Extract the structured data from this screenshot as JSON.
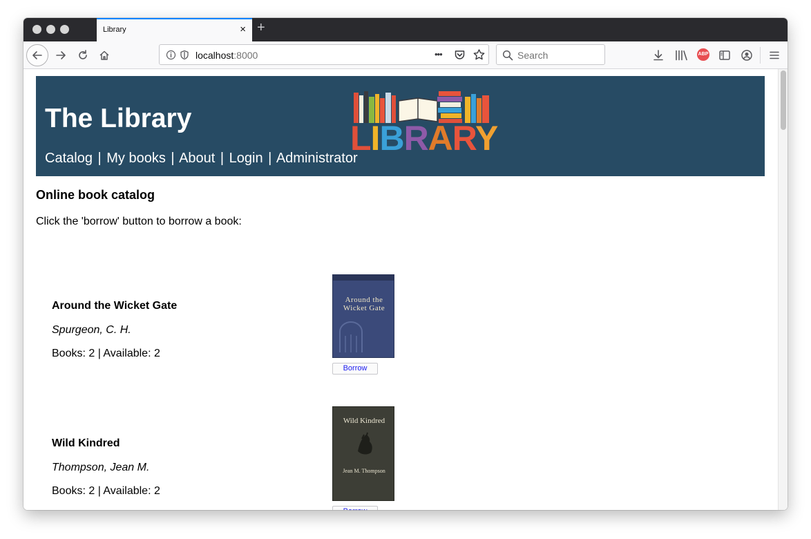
{
  "browser": {
    "tab_title": "Library",
    "tab_close": "×",
    "new_tab": "+",
    "url_host": "localhost",
    "url_port": ":8000",
    "search_placeholder": "Search",
    "page_actions_label": "•••",
    "abp_label": "ABP"
  },
  "header": {
    "site_title": "The Library",
    "nav": [
      "Catalog",
      "My books",
      "About",
      "Login",
      "Administrator"
    ],
    "nav_separator": "|",
    "logo_text": [
      "L",
      "I",
      "B",
      "R",
      "A",
      "R",
      "Y"
    ],
    "logo_colors": [
      "#e0503a",
      "#f0b429",
      "#3aa0d8",
      "#8e5aa8",
      "#e07b2a",
      "#e8543c",
      "#f0a030"
    ]
  },
  "main": {
    "heading": "Online book catalog",
    "intro": "Click the 'borrow' button to borrow a book:",
    "borrow_label": "Borrow",
    "books": [
      {
        "title": "Around the Wicket Gate",
        "author": "Spurgeon, C. H.",
        "stock": "Books: 2 | Available: 2",
        "cover_title": [
          "Around the",
          "Wicket Gate"
        ],
        "cover_color": "#3b4a7a"
      },
      {
        "title": "Wild Kindred",
        "author": "Thompson, Jean M.",
        "stock": "Books: 2 | Available: 2",
        "cover_title": [
          "Wild Kindred"
        ],
        "cover_author": "Jean M. Thompson",
        "cover_color": "#3d3e36"
      }
    ]
  }
}
